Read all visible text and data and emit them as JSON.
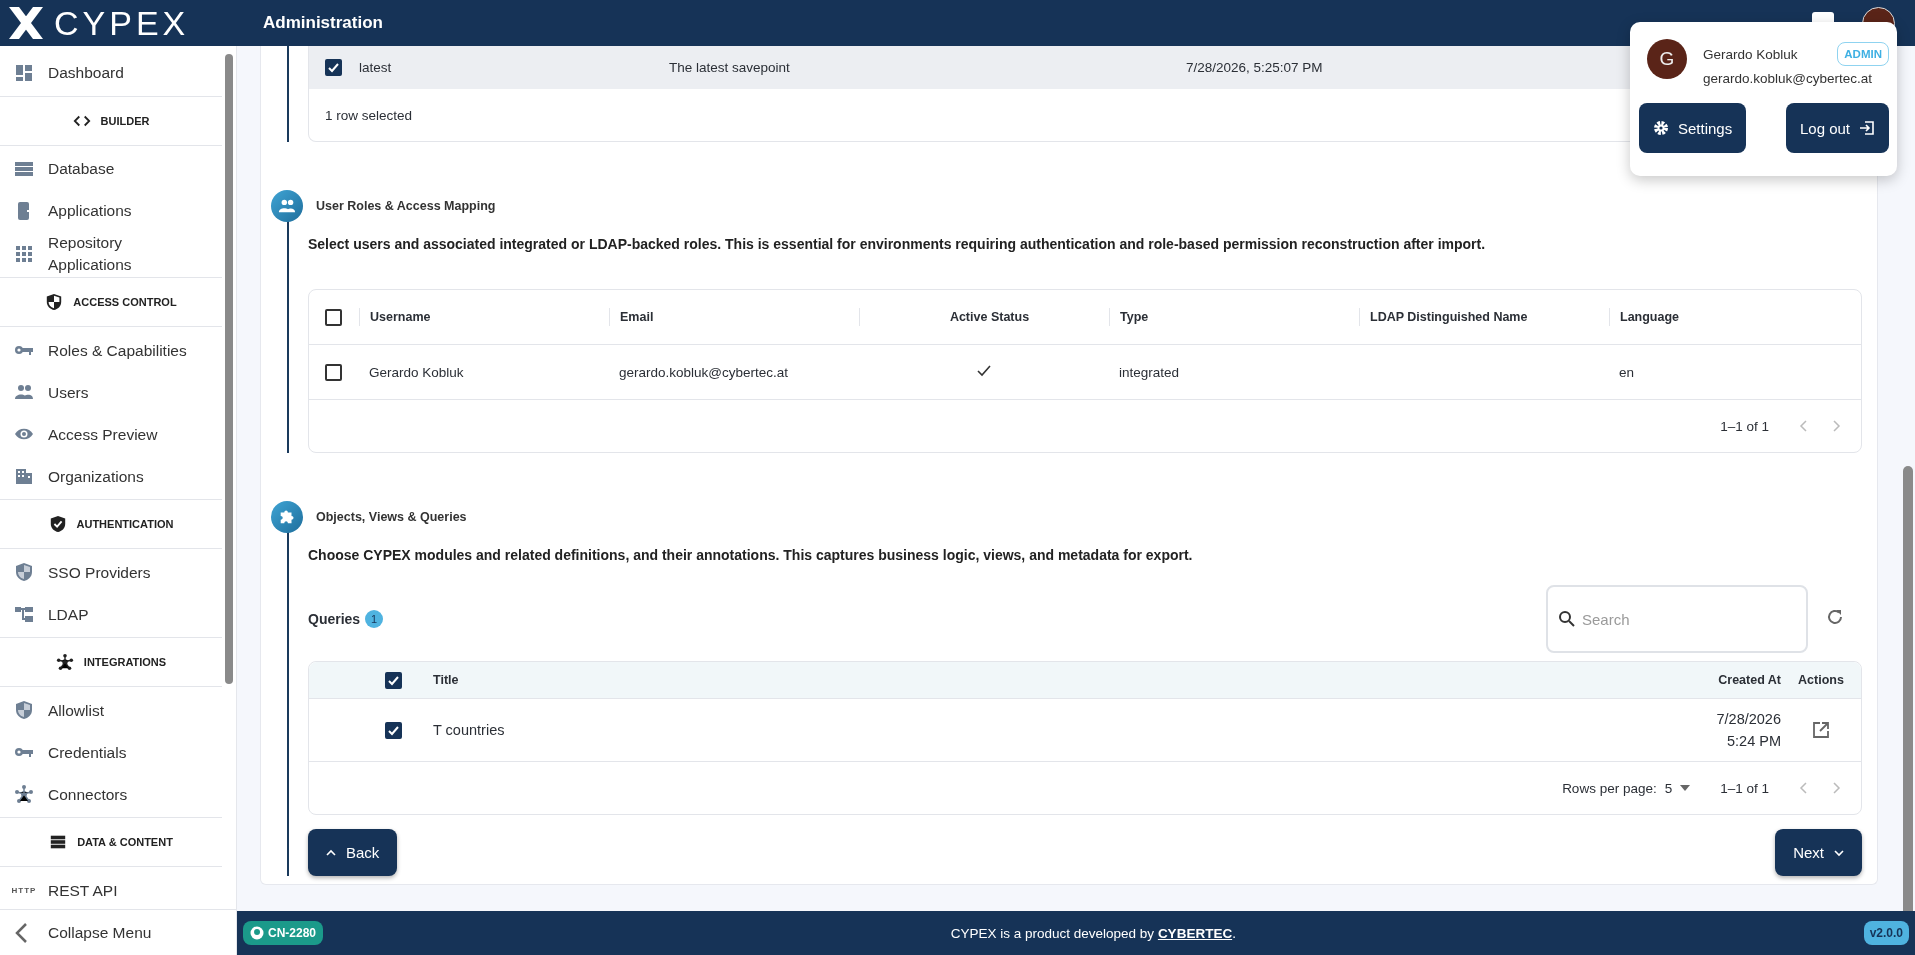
{
  "header": {
    "logo": "CYPEX",
    "title": "Administration"
  },
  "sidebar": {
    "items": [
      {
        "kind": "link",
        "label": "Dashboard"
      },
      {
        "kind": "section",
        "label": "BUILDER"
      },
      {
        "kind": "link",
        "label": "Database"
      },
      {
        "kind": "link",
        "label": "Applications"
      },
      {
        "kind": "link",
        "label": "Repository Applications"
      },
      {
        "kind": "section",
        "label": "ACCESS CONTROL"
      },
      {
        "kind": "link",
        "label": "Roles & Capabilities"
      },
      {
        "kind": "link",
        "label": "Users"
      },
      {
        "kind": "link",
        "label": "Access Preview"
      },
      {
        "kind": "link",
        "label": "Organizations"
      },
      {
        "kind": "section",
        "label": "AUTHENTICATION"
      },
      {
        "kind": "link",
        "label": "SSO Providers"
      },
      {
        "kind": "link",
        "label": "LDAP"
      },
      {
        "kind": "section",
        "label": "INTEGRATIONS"
      },
      {
        "kind": "link",
        "label": "Allowlist"
      },
      {
        "kind": "link",
        "label": "Credentials"
      },
      {
        "kind": "link",
        "label": "Connectors"
      },
      {
        "kind": "section",
        "label": "DATA & CONTENT"
      },
      {
        "kind": "link",
        "label": "REST API",
        "badge": "HTTP"
      }
    ],
    "collapse": "Collapse Menu"
  },
  "savepoints": {
    "rows": [
      {
        "selected": true,
        "cells": [
          "latest",
          "The latest savepoint",
          "7/28/2026, 5:25:07 PM"
        ]
      }
    ],
    "footer": "1 row selected"
  },
  "user_roles": {
    "title": "User Roles & Access Mapping",
    "description": "Select users and associated integrated or LDAP-backed roles. This is essential for environments requiring authentication and role-based permission reconstruction after import.",
    "all_selected": false,
    "columns": [
      "Username",
      "Email",
      "Active Status",
      "Type",
      "LDAP Distinguished Name",
      "Language"
    ],
    "rows": [
      {
        "selected": false,
        "username": "Gerardo Kobluk",
        "email": "gerardo.kobluk@cybertec.at",
        "active": true,
        "type": "integrated",
        "language": "en"
      }
    ],
    "pagination": "1–1 of 1"
  },
  "objects": {
    "title": "Objects, Views & Queries",
    "description": "Choose CYPEX modules and related definitions, and their annotations. This captures business logic, views, and metadata for export.",
    "queries": {
      "label": "Queries",
      "count": "1",
      "search": {
        "placeholder": "Search"
      },
      "all_selected": true,
      "columns": [
        "Title",
        "Created At",
        "Actions"
      ],
      "rows": [
        {
          "selected": true,
          "title": "T countries",
          "created": [
            "7/28/2026",
            "5:24 PM"
          ]
        }
      ],
      "rows_per_page_label": "Rows per page:",
      "rows_per_page": "5",
      "pagination": "1–1 of 1"
    }
  },
  "nav": {
    "back": "Back",
    "next": "Next"
  },
  "footer": {
    "chip": "CN-2280",
    "text": "CYPEX is a product developed by ",
    "link": "CYBERTEC",
    "suffix": ".",
    "version": "v2.0.0"
  },
  "user_menu": {
    "avatar": "G",
    "name": "Gerardo Kobluk",
    "role": "ADMIN",
    "email": "gerardo.kobluk@cybertec.at",
    "settings": "Settings",
    "logout": "Log out"
  }
}
